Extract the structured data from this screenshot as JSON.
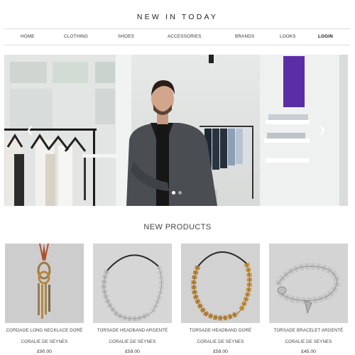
{
  "header": {
    "title": "NEW IN TODAY"
  },
  "nav": {
    "items": [
      {
        "label": "HOME"
      },
      {
        "label": "CLOTHING"
      },
      {
        "label": "SHOES"
      },
      {
        "label": "ACCESSORIES"
      },
      {
        "label": "BRANDS"
      },
      {
        "label": "LOOKS"
      },
      {
        "label": "LOGIN"
      }
    ]
  },
  "hero": {
    "prev_icon": "chevron-left-icon",
    "next_icon": "chevron-right-icon",
    "slide_count": 2,
    "active_slide": 1
  },
  "products": {
    "title": "NEW PRODUCTS",
    "items": [
      {
        "name": "CORDAGE LONG NECKLACE DORÉ",
        "brand": "CORALIE DE SEYNES",
        "price": "£90.00"
      },
      {
        "name": "TORSADE HEADBAND ARGENTÉ",
        "brand": "CORALIE DE SEYNES",
        "price": "£59.00"
      },
      {
        "name": "TORSADE HEADBAND DORÉ",
        "brand": "CORALIE DE SEYNES",
        "price": "£59.00"
      },
      {
        "name": "TORSADE BRACELET ARGENTÉ",
        "brand": "CORALIE DE SEYNES",
        "price": "£45.00"
      }
    ]
  },
  "colors": {
    "gold": "#b8873f",
    "silver": "#c8c8c8",
    "accent_purple": "#5a2ea6"
  }
}
